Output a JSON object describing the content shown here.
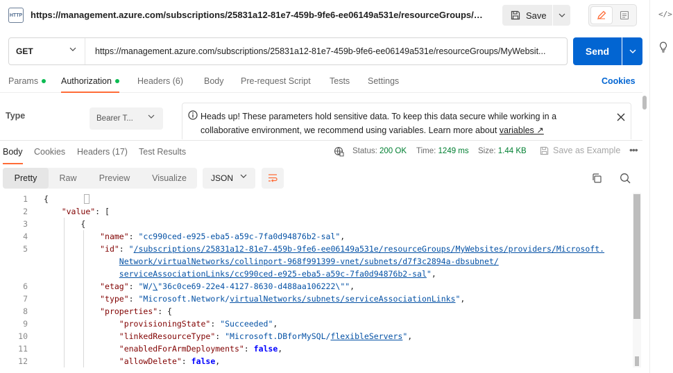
{
  "header": {
    "title_url": "https://management.azure.com/subscriptions/25831a12-81e7-459b-9fe6-ee06149a531e/resourceGroups/My...",
    "http_icon_text": "HTTP",
    "save_label": "Save"
  },
  "request": {
    "method": "GET",
    "url": "https://management.azure.com/subscriptions/25831a12-81e7-459b-9fe6-ee06149a531e/resourceGroups/MyWebsit...",
    "send_label": "Send"
  },
  "request_tabs": [
    {
      "label": "Params",
      "dot": true
    },
    {
      "label": "Authorization",
      "dot": true
    },
    {
      "label": "Headers (6)",
      "dot": false
    },
    {
      "label": "Body",
      "dot": false
    },
    {
      "label": "Pre-request Script",
      "dot": false
    },
    {
      "label": "Tests",
      "dot": false
    },
    {
      "label": "Settings",
      "dot": false
    }
  ],
  "cookies_link": "Cookies",
  "auth": {
    "type_label": "Type",
    "type_value": "Bearer T...",
    "banner_text": "Heads up! These parameters hold sensitive data. To keep this data secure while working in a collaborative environment, we recommend using variables. Learn more about ",
    "banner_link": "variables ↗"
  },
  "response_tabs": [
    {
      "label": "Body"
    },
    {
      "label": "Cookies"
    },
    {
      "label": "Headers (17)"
    },
    {
      "label": "Test Results"
    }
  ],
  "response_meta": {
    "status_label": "Status:",
    "status_value": "200 OK",
    "time_label": "Time:",
    "time_value": "1249 ms",
    "size_label": "Size:",
    "size_value": "1.44 KB",
    "save_example": "Save as Example",
    "more": "•••"
  },
  "view_options": [
    "Pretty",
    "Raw",
    "Preview",
    "Visualize"
  ],
  "format": "JSON",
  "colors": {
    "accent_orange": "#ff6c37",
    "send_blue": "#0265d2",
    "status_green": "#007f31",
    "dot_green": "#0cbb52"
  },
  "code_lines": [
    {
      "num": "1",
      "html": "<span class=\"bracket-box\"></span><span style=\"position:relative;left:2px\">{</span>"
    },
    {
      "num": "2",
      "html": "    <span class=\"k\">\"value\"</span>: ["
    },
    {
      "num": "3",
      "html": "        {"
    },
    {
      "num": "4",
      "html": "            <span class=\"k\">\"name\"</span>: <span class=\"s\">\"cc990ced-e925-eba5-a59c-7fa0d94876b2-sal\"</span>,"
    },
    {
      "num": "5",
      "html": "            <span class=\"k\">\"id\"</span>: <span class=\"s\">\"<span class=\"u\">/subscriptions/25831a12-81e7-459b-9fe6-ee06149a531e/resourceGroups/MyWebsites/providers/Microsoft.</span></span>"
    },
    {
      "num": "",
      "html": "                <span class=\"s u\">Network/virtualNetworks/collinport-968f991399-vnet/subnets/d7f3c2894a-dbsubnet/</span>"
    },
    {
      "num": "",
      "html": "                <span class=\"s\"><span class=\"u\">serviceAssociationLinks/cc990ced-e925-eba5-a59c-7fa0d94876b2-sal</span>\"</span>,"
    },
    {
      "num": "6",
      "html": "            <span class=\"k\">\"etag\"</span>: <span class=\"s\">\"W/<span class=\"u\">\\</span>\"36c0ce69-22e4-4127-8630-d488aa106222\\\"\"</span>,"
    },
    {
      "num": "7",
      "html": "            <span class=\"k\">\"type\"</span>: <span class=\"s\">\"Microsoft.Network/<span class=\"u\">virtualNetworks/subnets/serviceAssociationLinks</span>\"</span>,"
    },
    {
      "num": "8",
      "html": "            <span class=\"k\">\"properties\"</span>: {"
    },
    {
      "num": "9",
      "html": "                <span class=\"k\">\"provisioningState\"</span>: <span class=\"s\">\"Succeeded\"</span>,"
    },
    {
      "num": "10",
      "html": "                <span class=\"k\">\"linkedResourceType\"</span>: <span class=\"s\">\"Microsoft.DBforMySQL/<span class=\"u\">flexibleServers</span>\"</span>,"
    },
    {
      "num": "11",
      "html": "                <span class=\"k\">\"enabledForArmDeployments\"</span>: <span class=\"b\">false</span>,"
    },
    {
      "num": "12",
      "html": "                <span class=\"k\">\"allowDelete\"</span>: <span class=\"b\">false</span>,"
    }
  ]
}
